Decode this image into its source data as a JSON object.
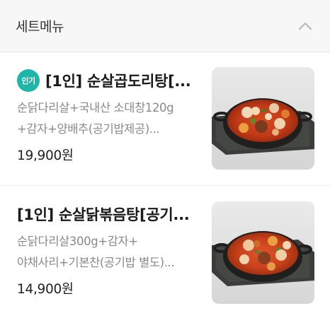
{
  "section": {
    "title": "세트메뉴",
    "toggle_icon": "chevron-up-icon"
  },
  "items": [
    {
      "badge": "인기",
      "title": "[1인] 순살곱도리탕[...",
      "desc_line1": "순닭다리살+국내산 소대창120g",
      "desc_line2": "+감자+양배추(공기밥제공)...",
      "price": "19,900원"
    },
    {
      "title": "[1인] 순살닭볶음탕[공기...",
      "desc_line1": "순닭다리살300g+감자+",
      "desc_line2": "야채사리+기본찬(공기밥 별도)...",
      "price": "14,900원"
    }
  ],
  "colors": {
    "badge": "#1eb6a9",
    "header_bg": "#f7f7f7",
    "desc": "#8a8a8a"
  }
}
